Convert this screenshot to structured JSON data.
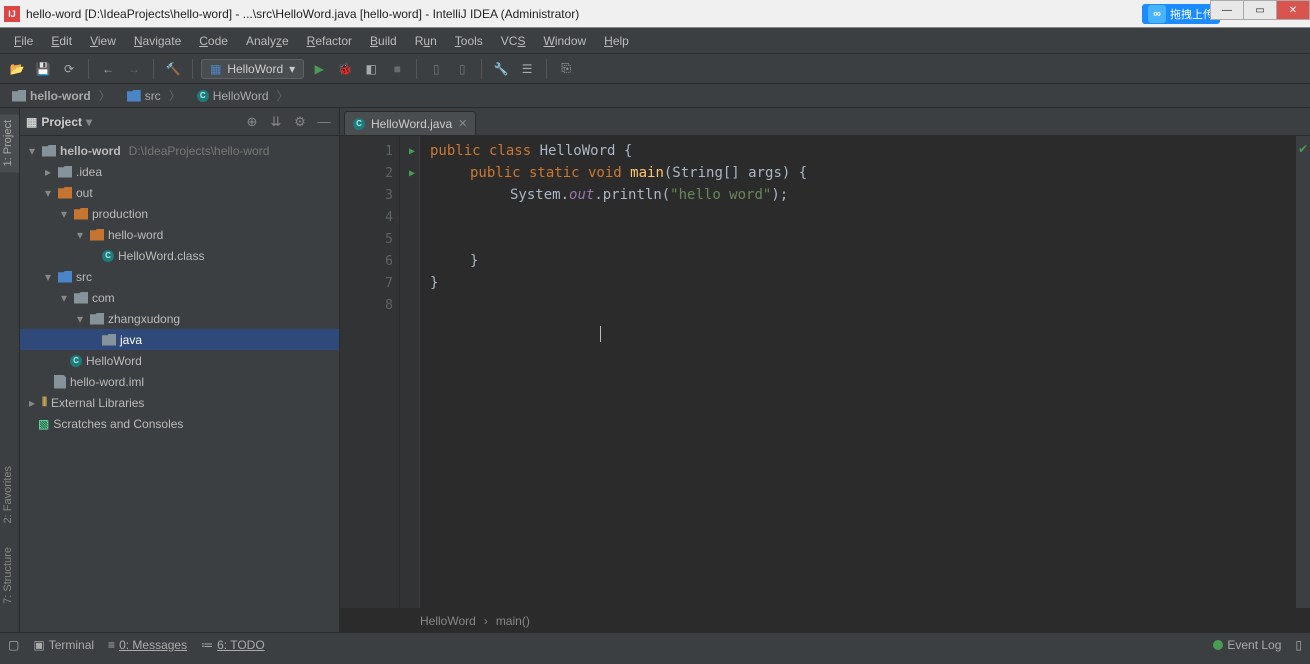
{
  "window": {
    "title": "hello-word [D:\\IdeaProjects\\hello-word] - ...\\src\\HelloWord.java [hello-word] - IntelliJ IDEA (Administrator)",
    "float_text": "拖拽上传"
  },
  "menubar": [
    "File",
    "Edit",
    "View",
    "Navigate",
    "Code",
    "Analyze",
    "Refactor",
    "Build",
    "Run",
    "Tools",
    "VCS",
    "Window",
    "Help"
  ],
  "toolbar": {
    "run_config": "HelloWord"
  },
  "navbar": {
    "crumbs": [
      "hello-word",
      "src",
      "HelloWord"
    ]
  },
  "project_panel": {
    "title": "Project",
    "tree": {
      "root": "hello-word",
      "root_path": "D:\\IdeaProjects\\hello-word",
      "idea": ".idea",
      "out": "out",
      "production": "production",
      "hw_out": "hello-word",
      "hw_class": "HelloWord.class",
      "src": "src",
      "com": "com",
      "zhang": "zhangxudong",
      "java_pkg": "java",
      "hw_java": "HelloWord",
      "iml": "hello-word.iml",
      "ext_lib": "External Libraries",
      "scratch": "Scratches and Consoles"
    }
  },
  "editor": {
    "tab_name": "HelloWord.java",
    "lines": [
      "1",
      "2",
      "3",
      "4",
      "5",
      "6",
      "7",
      "8"
    ],
    "code": {
      "l1_kw": "public class ",
      "l1_cn": "HelloWord ",
      "l1_b": "{",
      "l2_kw": "public static void ",
      "l2_mn": "main",
      "l2_p": "(String[] args) {",
      "l3_a": "System.",
      "l3_b": "out",
      "l3_c": ".println(",
      "l3_s": "\"hello word\"",
      "l3_d": ");",
      "l6": "}",
      "l7": "}"
    },
    "breadcrumb": {
      "a": "HelloWord",
      "b": "main()"
    }
  },
  "side_tabs": {
    "project": "1: Project",
    "favorites": "2: Favorites",
    "structure": "7: Structure"
  },
  "status": {
    "terminal": "Terminal",
    "messages": "0: Messages",
    "todo": "6: TODO",
    "event_log": "Event Log"
  }
}
